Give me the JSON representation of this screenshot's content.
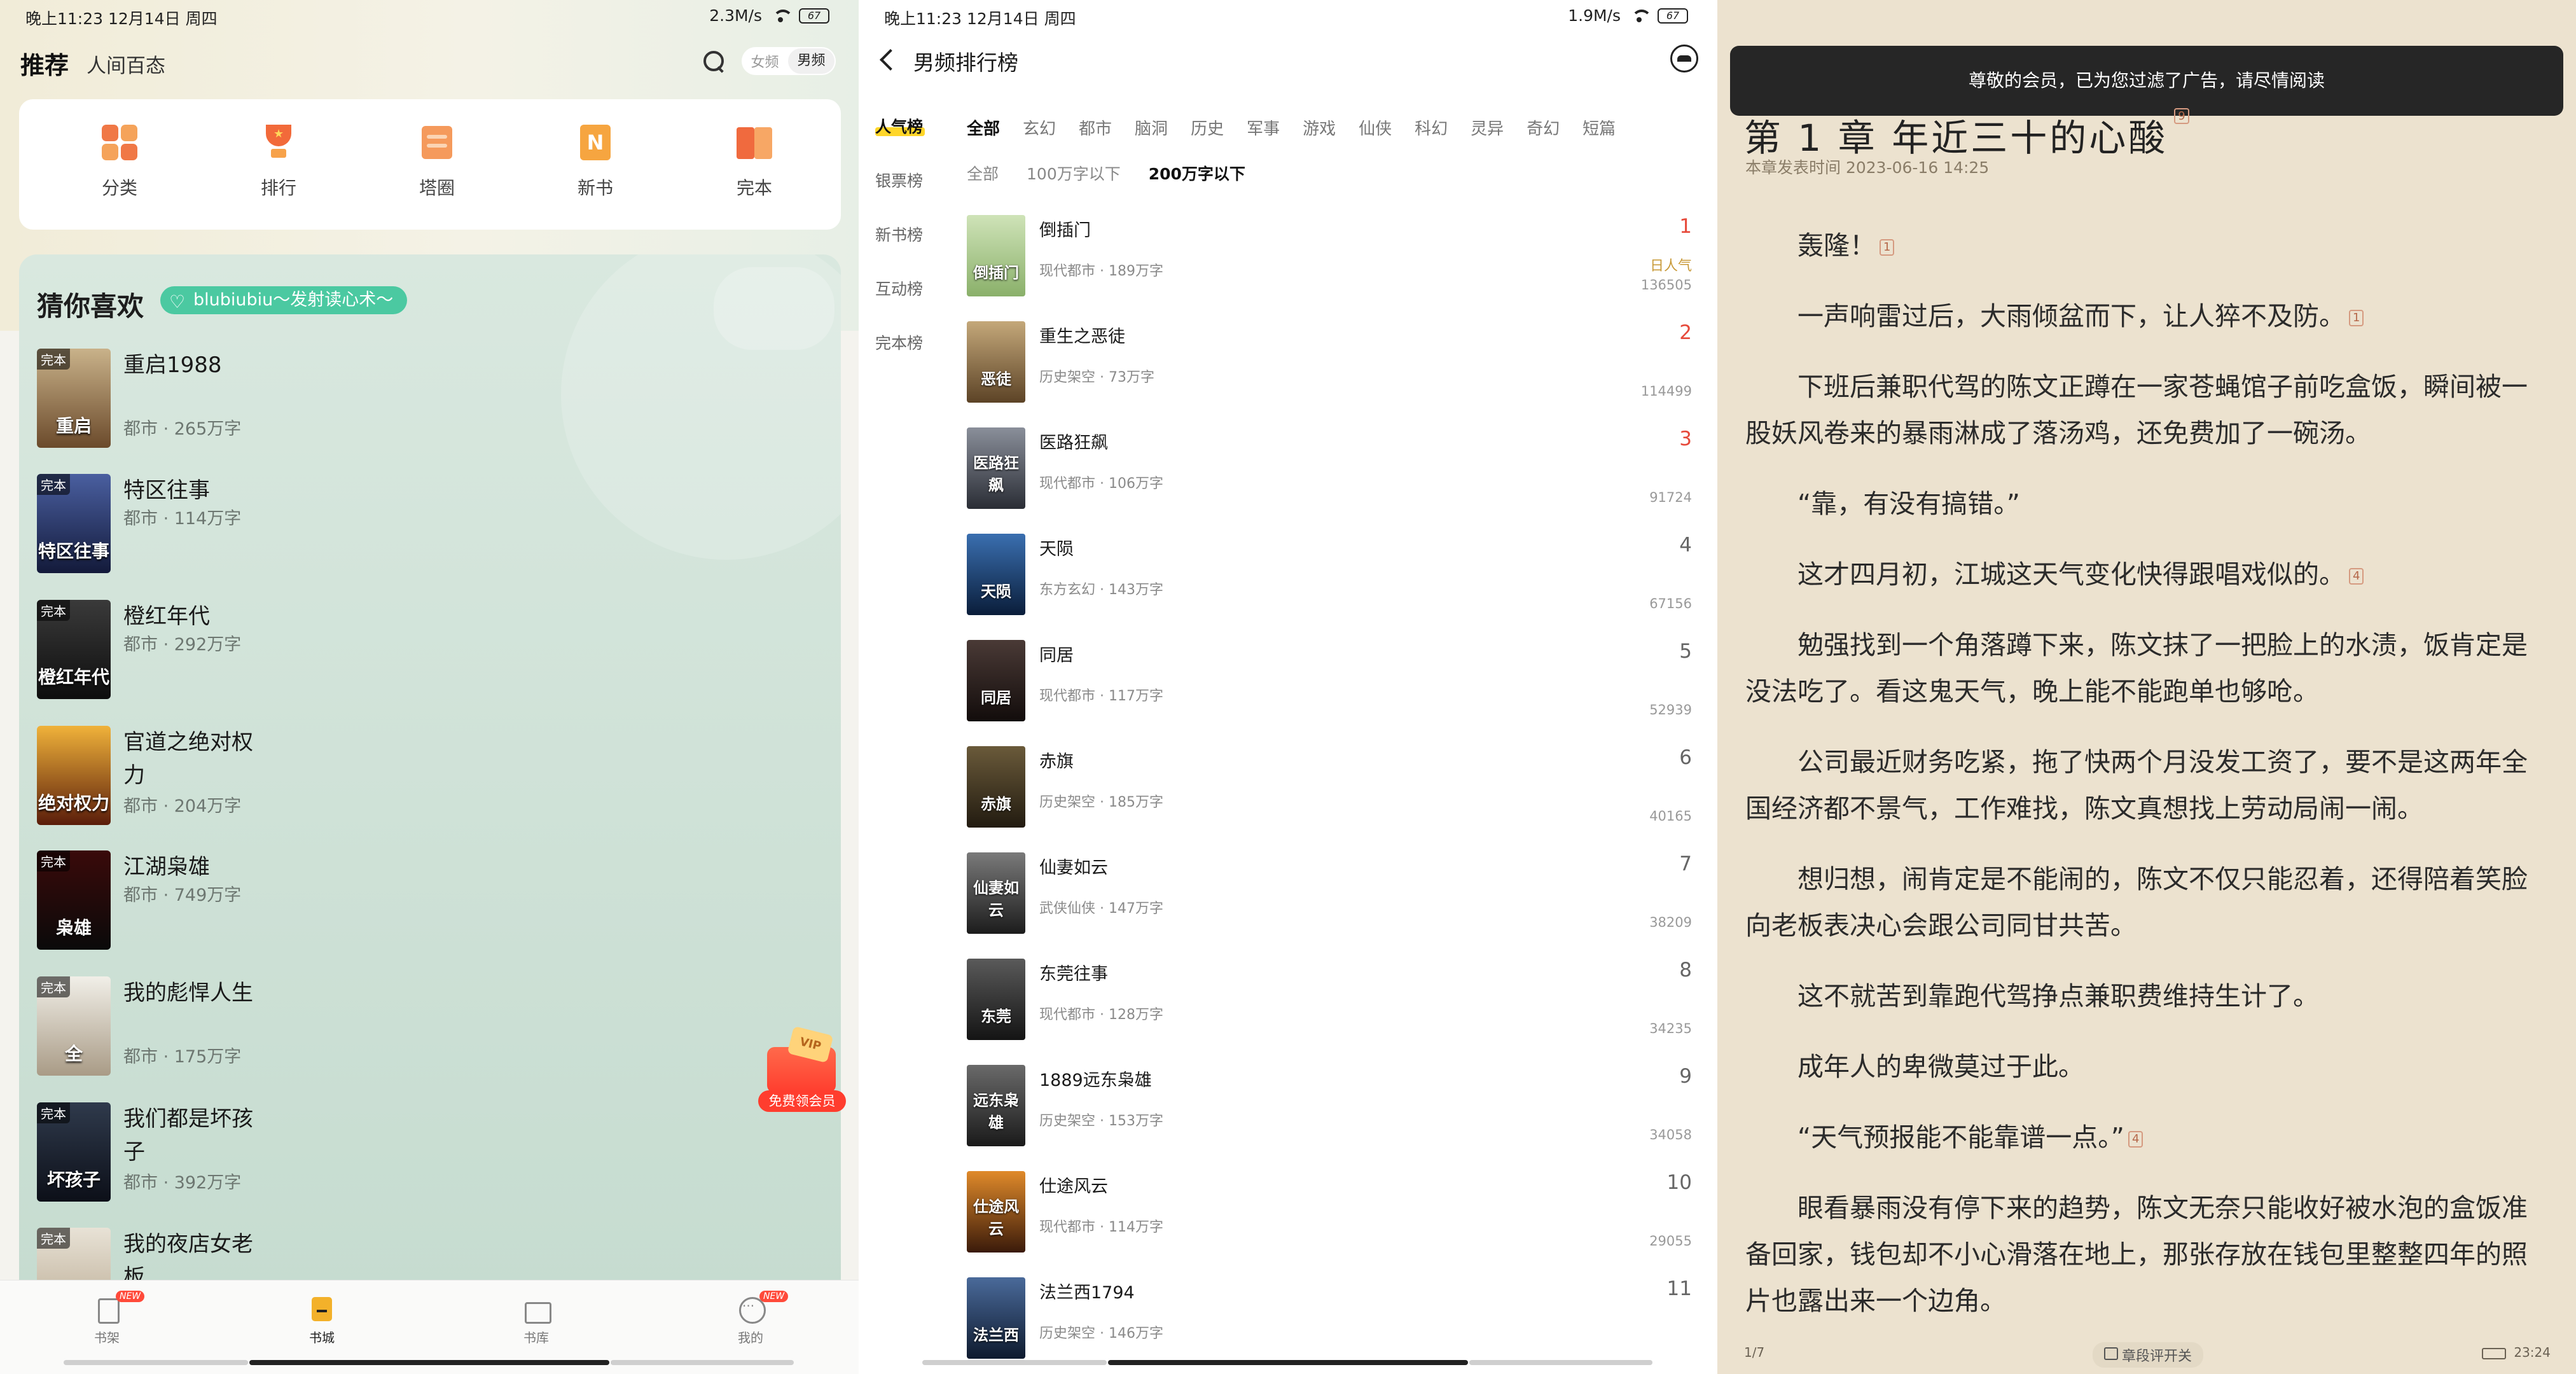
{
  "pane1": {
    "status": {
      "time": "晚上11:23 12月14日 周四",
      "speed": "2.3M/s",
      "battery": "67"
    },
    "header": {
      "tab_active": "推荐",
      "tab2": "人间百态",
      "gender_female": "女频",
      "gender_male": "男频"
    },
    "quick": [
      {
        "label": "分类",
        "icon": "category-icon"
      },
      {
        "label": "排行",
        "icon": "trophy-icon"
      },
      {
        "label": "塔圈",
        "icon": "tower-icon"
      },
      {
        "label": "新书",
        "icon": "new-book-icon"
      },
      {
        "label": "完本",
        "icon": "finished-book-icon"
      }
    ],
    "rec_title": "猜你喜欢",
    "rec_tag": "blubiubiu～发射读心术～",
    "books": [
      {
        "title": "重启1988",
        "meta": "都市 · 265万字",
        "tag": "完本",
        "cover_text": "重启",
        "c1": "#c9b28a",
        "c2": "#6b4a2b"
      },
      {
        "title": "特区往事",
        "meta": "都市 · 114万字",
        "tag": "完本",
        "cover_text": "特区往事",
        "c1": "#4a5fa0",
        "c2": "#131a3a"
      },
      {
        "title": "橙红年代",
        "meta": "都市 · 292万字",
        "tag": "完本",
        "cover_text": "橙红年代",
        "c1": "#3a3a3a",
        "c2": "#0d0d0d"
      },
      {
        "title": "官道之绝对权力",
        "meta": "都市 · 204万字",
        "tag": "",
        "cover_text": "绝对权力",
        "c1": "#f0b23a",
        "c2": "#5a1d0a"
      },
      {
        "title": "江湖枭雄",
        "meta": "都市 · 749万字",
        "tag": "完本",
        "cover_text": "枭雄",
        "c1": "#3a0a0a",
        "c2": "#0a0a0a"
      },
      {
        "title": "我的彪悍人生",
        "meta": "都市 · 175万字",
        "tag": "完本",
        "cover_text": "全",
        "c1": "#f1efe8",
        "c2": "#a99b86"
      },
      {
        "title": "我们都是坏孩子",
        "meta": "都市 · 392万字",
        "tag": "完本",
        "cover_text": "坏孩子",
        "c1": "#2f3a4c",
        "c2": "#0c0f18"
      },
      {
        "title": "我的夜店女老板",
        "meta": "",
        "tag": "完本",
        "cover_text": "",
        "c1": "#e8e2d6",
        "c2": "#b7a78e"
      }
    ],
    "vip_label": "免费领会员",
    "vip_card": "VIP",
    "nav": [
      {
        "label": "书架",
        "badge": "NEW"
      },
      {
        "label": "书城",
        "badge": ""
      },
      {
        "label": "书库",
        "badge": ""
      },
      {
        "label": "我的",
        "badge": "NEW"
      }
    ]
  },
  "pane2": {
    "status": {
      "time": "晚上11:23 12月14日 周四",
      "speed": "1.9M/s",
      "battery": "67"
    },
    "title": "男频排行榜",
    "side": [
      "人气榜",
      "银票榜",
      "新书榜",
      "互动榜",
      "完本榜"
    ],
    "cats": [
      "全部",
      "玄幻",
      "都市",
      "脑洞",
      "历史",
      "军事",
      "游戏",
      "仙侠",
      "科幻",
      "灵异",
      "奇幻",
      "短篇"
    ],
    "subcats": [
      "全部",
      "100万字以下",
      "200万字以下"
    ],
    "pop_label": "日人气",
    "ranks": [
      {
        "rank": "1",
        "name": "倒插门",
        "meta": "现代都市 · 189万字",
        "value": "136505",
        "cover_text": "倒插门",
        "c1": "#cfe3b8",
        "c2": "#8ab06a"
      },
      {
        "rank": "2",
        "name": "重生之恶徒",
        "meta": "历史架空 · 73万字",
        "value": "114499",
        "cover_text": "恶徒",
        "c1": "#c4a87a",
        "c2": "#5c4326"
      },
      {
        "rank": "3",
        "name": "医路狂飙",
        "meta": "现代都市 · 106万字",
        "value": "91724",
        "cover_text": "医路狂飙",
        "c1": "#8a8f9a",
        "c2": "#2a2d35"
      },
      {
        "rank": "4",
        "name": "天陨",
        "meta": "东方玄幻 · 143万字",
        "value": "67156",
        "cover_text": "天陨",
        "c1": "#3a6fb0",
        "c2": "#0a1d3a"
      },
      {
        "rank": "5",
        "name": "同居",
        "meta": "现代都市 · 117万字",
        "value": "52939",
        "cover_text": "同居",
        "c1": "#4a3a36",
        "c2": "#120c0b"
      },
      {
        "rank": "6",
        "name": "赤旗",
        "meta": "历史架空 · 185万字",
        "value": "40165",
        "cover_text": "赤旗",
        "c1": "#6a5a3a",
        "c2": "#221b10"
      },
      {
        "rank": "7",
        "name": "仙妻如云",
        "meta": "武侠仙侠 · 147万字",
        "value": "38209",
        "cover_text": "仙妻如云",
        "c1": "#7a7a7a",
        "c2": "#1c1c1c"
      },
      {
        "rank": "8",
        "name": "东莞往事",
        "meta": "现代都市 · 128万字",
        "value": "34235",
        "cover_text": "东莞",
        "c1": "#5a5a5a",
        "c2": "#141414"
      },
      {
        "rank": "9",
        "name": "1889远东枭雄",
        "meta": "历史架空 · 153万字",
        "value": "34058",
        "cover_text": "远东枭雄",
        "c1": "#6a6a6a",
        "c2": "#1a1a1a"
      },
      {
        "rank": "10",
        "name": "仕途风云",
        "meta": "现代都市 · 114万字",
        "value": "29055",
        "cover_text": "仕途风云",
        "c1": "#e08a2a",
        "c2": "#3a1a0a"
      },
      {
        "rank": "11",
        "name": "法兰西1794",
        "meta": "历史架空 · 146万字",
        "value": "",
        "cover_text": "法兰西",
        "c1": "#4a6a9a",
        "c2": "#0e1a2e"
      }
    ]
  },
  "pane3": {
    "toast": "尊敬的会员，已为您过滤了广告，请尽情阅读",
    "chapter": "第 1 章 年近三十的心酸",
    "chapter_comments": "9",
    "published": "本章发表时间 2023-06-16 14:25",
    "paragraphs": [
      {
        "text": "轰隆！",
        "c": "1"
      },
      {
        "text": "一声响雷过后，大雨倾盆而下，让人猝不及防。",
        "c": "1"
      },
      {
        "text": "下班后兼职代驾的陈文正蹲在一家苍蝇馆子前吃盒饭，瞬间被一股妖风卷来的暴雨淋成了落汤鸡，还免费加了一碗汤。",
        "c": ""
      },
      {
        "text": "“靠，有没有搞错。”",
        "c": ""
      },
      {
        "text": "这才四月初，江城这天气变化快得跟唱戏似的。",
        "c": "4"
      },
      {
        "text": "勉强找到一个角落蹲下来，陈文抹了一把脸上的水渍，饭肯定是没法吃了。看这鬼天气，晚上能不能跑单也够呛。",
        "c": ""
      },
      {
        "text": "公司最近财务吃紧，拖了快两个月没发工资了，要不是这两年全国经济都不景气，工作难找，陈文真想找上劳动局闹一闹。",
        "c": ""
      },
      {
        "text": "想归想，闹肯定是不能闹的，陈文不仅只能忍着，还得陪着笑脸向老板表决心会跟公司同甘共苦。",
        "c": ""
      },
      {
        "text": "这不就苦到靠跑代驾挣点兼职费维持生计了。",
        "c": ""
      },
      {
        "text": "成年人的卑微莫过于此。",
        "c": ""
      },
      {
        "text": "“天气预报能不能靠谱一点。”",
        "c": "4"
      },
      {
        "text": "眼看暴雨没有停下来的趋势，陈文无奈只能收好被水泡的盒饭准备回家，钱包却不小心滑落在地上，那张存放在钱包里整整四年的照片也露出来一个边角。",
        "c": ""
      }
    ],
    "footer": {
      "page": "1/7",
      "switch": "章段评开关",
      "time": "23:24"
    }
  }
}
